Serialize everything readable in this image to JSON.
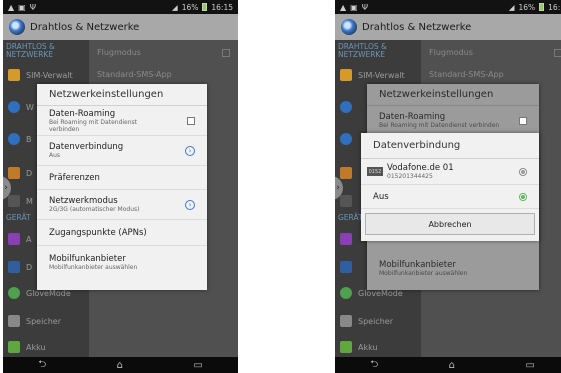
{
  "status": {
    "battery": "16%",
    "time_left": "16:15",
    "time_right": "16:1"
  },
  "app": {
    "title": "Drahtlos & Netzwerke"
  },
  "settings": {
    "section_wireless": "DRAHTLOS & NETZWERKE",
    "section_device": "GERÄT",
    "left_items": [
      "SIM-Verwalt",
      "W",
      "B",
      "D",
      "M",
      "A",
      "D",
      "GloveMode",
      "Speicher",
      "Akku"
    ],
    "right_items": [
      "Flugmodus",
      "Standard-SMS-App"
    ]
  },
  "dialog_network": {
    "title": "Netzwerkeinstellungen",
    "items": [
      {
        "title": "Daten-Roaming",
        "subtitle": "Bei Roaming mit Datendienst verbinden"
      },
      {
        "title": "Datenverbindung",
        "subtitle": "Aus"
      },
      {
        "title": "Präferenzen",
        "subtitle": ""
      },
      {
        "title": "Netzwerkmodus",
        "subtitle": "2G/3G (automatischer Modus)"
      },
      {
        "title": "Zugangspunkte (APNs)",
        "subtitle": ""
      },
      {
        "title": "Mobilfunkanbieter",
        "subtitle": "Mobilfunkanbieter auswählen"
      }
    ]
  },
  "dialog_data": {
    "title": "Datenverbindung",
    "options": [
      {
        "label": "Vodafone.de 01",
        "sub": "015201344425",
        "badge": "0152",
        "selected": false
      },
      {
        "label": "Aus",
        "sub": "",
        "selected": true
      }
    ],
    "cancel": "Abbrechen"
  }
}
